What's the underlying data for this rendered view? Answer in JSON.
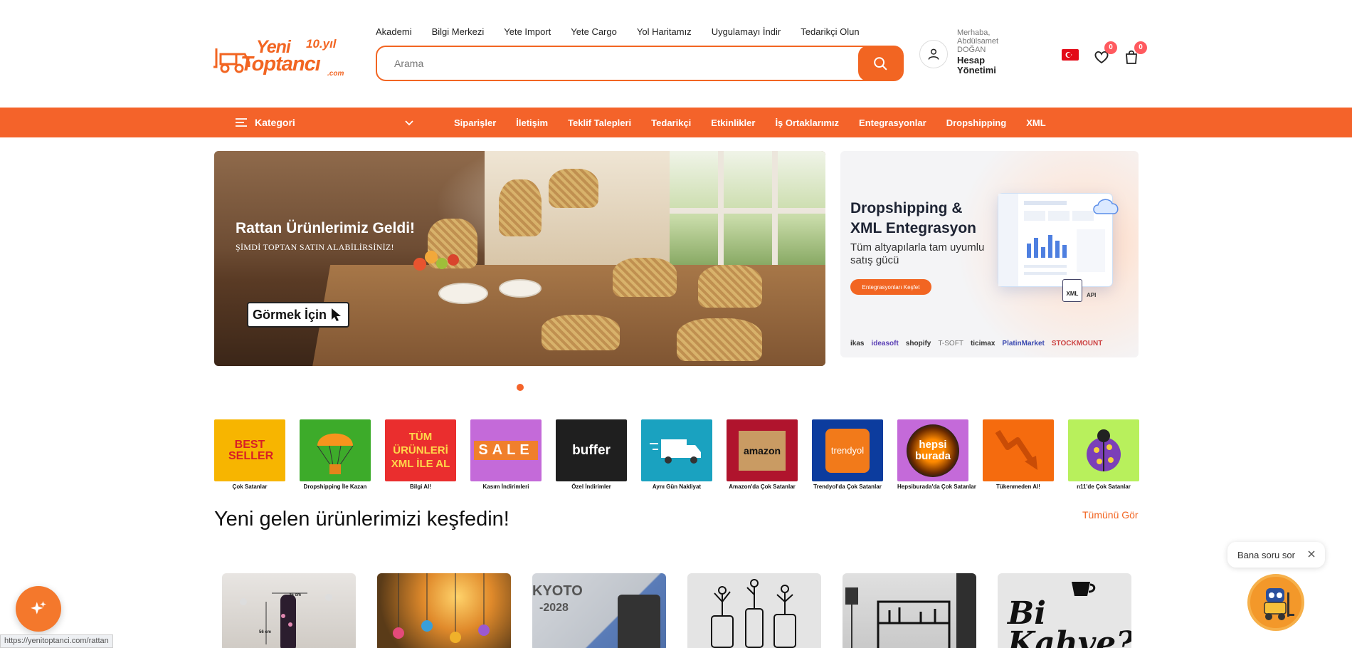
{
  "brand": {
    "name_line1": "Yeni",
    "name_line2": "Toptancı",
    "years": "10.yıl",
    "domain": ".com",
    "color": "#f26522"
  },
  "top_nav": [
    "Akademi",
    "Bilgi Merkezi",
    "Yete Import",
    "Yete Cargo",
    "Yol Haritamız",
    "Uygulamayı İndir",
    "Tedarikçi Olun"
  ],
  "search": {
    "placeholder": "Arama",
    "icon": "search-icon"
  },
  "account": {
    "greeting": "Merhaba,",
    "user": "Abdülsamet DOĞAN",
    "link_line1": "Hesap",
    "link_line2": "Yönetimi",
    "icon": "user-icon"
  },
  "header_actions": {
    "flag": "turkey-flag-icon",
    "favorites_count": "0",
    "cart_count": "0"
  },
  "category_nav": {
    "label": "Kategori",
    "items": [
      "Siparişler",
      "İletişim",
      "Teklif Talepleri",
      "Tedarikçi",
      "Etkinlikler",
      "İş Ortaklarımız",
      "Entegrasyonlar",
      "Dropshipping",
      "XML"
    ]
  },
  "hero": {
    "title": "Rattan Ürünlerimiz Geldi!",
    "subtitle": "ŞİMDİ TOPTAN SATIN ALABİLİRSİNİZ!",
    "cta": "Görmek İçin"
  },
  "side_banner": {
    "title": "Dropshipping & XML Entegrasyon",
    "description": "Tüm altyapılarla tam uyumlu satış gücü",
    "button": "Entegrasyonları Keşfet",
    "badge": "API",
    "xml_tag": "XML",
    "partners": [
      "ikas",
      "ideasoft",
      "shopify",
      "T-SOFT",
      "ticimax",
      "PlatinMarket",
      "STOCKMOUNT"
    ]
  },
  "categories": [
    {
      "label": "Çok Satanlar",
      "tile_text": "BEST SELLER",
      "color": "#f7b500"
    },
    {
      "label": "Dropshipping İle Kazan",
      "tile_text": "",
      "color": "#3dab2a"
    },
    {
      "label": "Bilgi Al!",
      "tile_text": "TÜM ÜRÜNLERİ XML İLE AL",
      "color": "#ea2e2e"
    },
    {
      "label": "Kasım İndirimleri",
      "tile_text": "SALE",
      "color": "#c46ad9"
    },
    {
      "label": "Özel İndirimler",
      "tile_text": "buffer",
      "color": "#1f1f1f"
    },
    {
      "label": "Aynı Gün Nakliyat",
      "tile_text": "",
      "color": "#1aa2c0"
    },
    {
      "label": "Amazon'da Çok Satanlar",
      "tile_text": "amazon",
      "color": "#b0142d"
    },
    {
      "label": "Trendyol'da Çok Satanlar",
      "tile_text": "trendyol",
      "color": "#0c3c9e"
    },
    {
      "label": "Hepsiburada'da Çok Satanlar",
      "tile_text": "hepsi burada",
      "color": "#c46ad9"
    },
    {
      "label": "Tükenmeden Al!",
      "tile_text": "",
      "color": "#f56b0e"
    },
    {
      "label": "n11'de Çok Satanlar",
      "tile_text": "",
      "color": "#b8f05c"
    }
  ],
  "section": {
    "title": "Yeni gelen ürünlerimizi keşfedin!",
    "see_all": "Tümünü Gör"
  },
  "products": [
    {
      "name": "guitar-wall-decor",
      "label_a": "35 cm",
      "label_b": "56 cm"
    },
    {
      "name": "wind-chime-decor"
    },
    {
      "name": "satellite-receiver",
      "label_a": "KYOTO",
      "label_b": "-2028"
    },
    {
      "name": "flower-jar-wall-art"
    },
    {
      "name": "plant-shelf-wall-art"
    },
    {
      "name": "bi-kahve-wall-art",
      "label_a": "Bi Kahve?"
    }
  ],
  "chat": {
    "prompt": "Bana soru sor"
  },
  "status_url": "https://yenitoptanci.com/rattan"
}
